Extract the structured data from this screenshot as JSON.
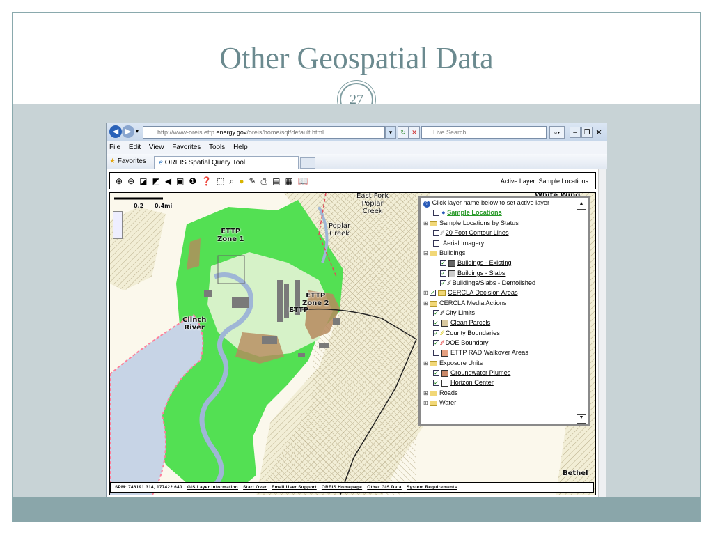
{
  "slide": {
    "title": "Other Geospatial Data",
    "number": "27"
  },
  "browser": {
    "url_prefix": "http://www-oreis.ettp.",
    "url_domain": "energy.gov",
    "url_suffix": "/oreis/home/sqt/default.html",
    "search_placeholder": "Live Search",
    "menu": [
      "File",
      "Edit",
      "View",
      "Favorites",
      "Tools",
      "Help"
    ],
    "favorites_label": "Favorites",
    "tab_title": "OREIS Spatial Query Tool"
  },
  "toolbar": {
    "active_layer": "Active Layer: Sample Locations"
  },
  "map": {
    "scale_labels": [
      "0.2",
      "0.4mi"
    ],
    "labels": {
      "ettp_zone1": "ETTP\nZone 1",
      "ettp_zone2": "ETTP\nZone 2",
      "ettp": "ETTP",
      "clinch_river": "Clinch\nRiver",
      "east_fork": "East Fork\nPoplar\nCreek",
      "poplar_creek": "Poplar\nCreek",
      "white_wing": "White Wing",
      "bethel": "Bethel"
    },
    "status_coords": "SPM: 746191.314, 177422.640",
    "status_links": [
      "GIS Layer Information",
      "Start Over",
      "Email User Support",
      "OREIS Homepage",
      "Other GIS Data",
      "System Requirements"
    ]
  },
  "layers": {
    "header": "Click layer name below to set active layer",
    "items": [
      {
        "label": "Sample Locations"
      },
      {
        "label": "Sample Locations by Status"
      },
      {
        "label": "20 Foot Contour Lines"
      },
      {
        "label": "Aerial Imagery"
      },
      {
        "label": "Buildings"
      },
      {
        "label": "Buildings - Existing"
      },
      {
        "label": "Buildings - Slabs"
      },
      {
        "label": "Buildings/Slabs - Demolished"
      },
      {
        "label": "CERCLA Decision Areas"
      },
      {
        "label": "CERCLA Media Actions"
      },
      {
        "label": "City Limits"
      },
      {
        "label": "Clean Parcels"
      },
      {
        "label": "County Boundaries"
      },
      {
        "label": "DOE Boundary"
      },
      {
        "label": "ETTP RAD Walkover Areas"
      },
      {
        "label": "Exposure Units"
      },
      {
        "label": "Groundwater Plumes"
      },
      {
        "label": "Horizon Center"
      },
      {
        "label": "Roads"
      },
      {
        "label": "Water"
      }
    ]
  }
}
